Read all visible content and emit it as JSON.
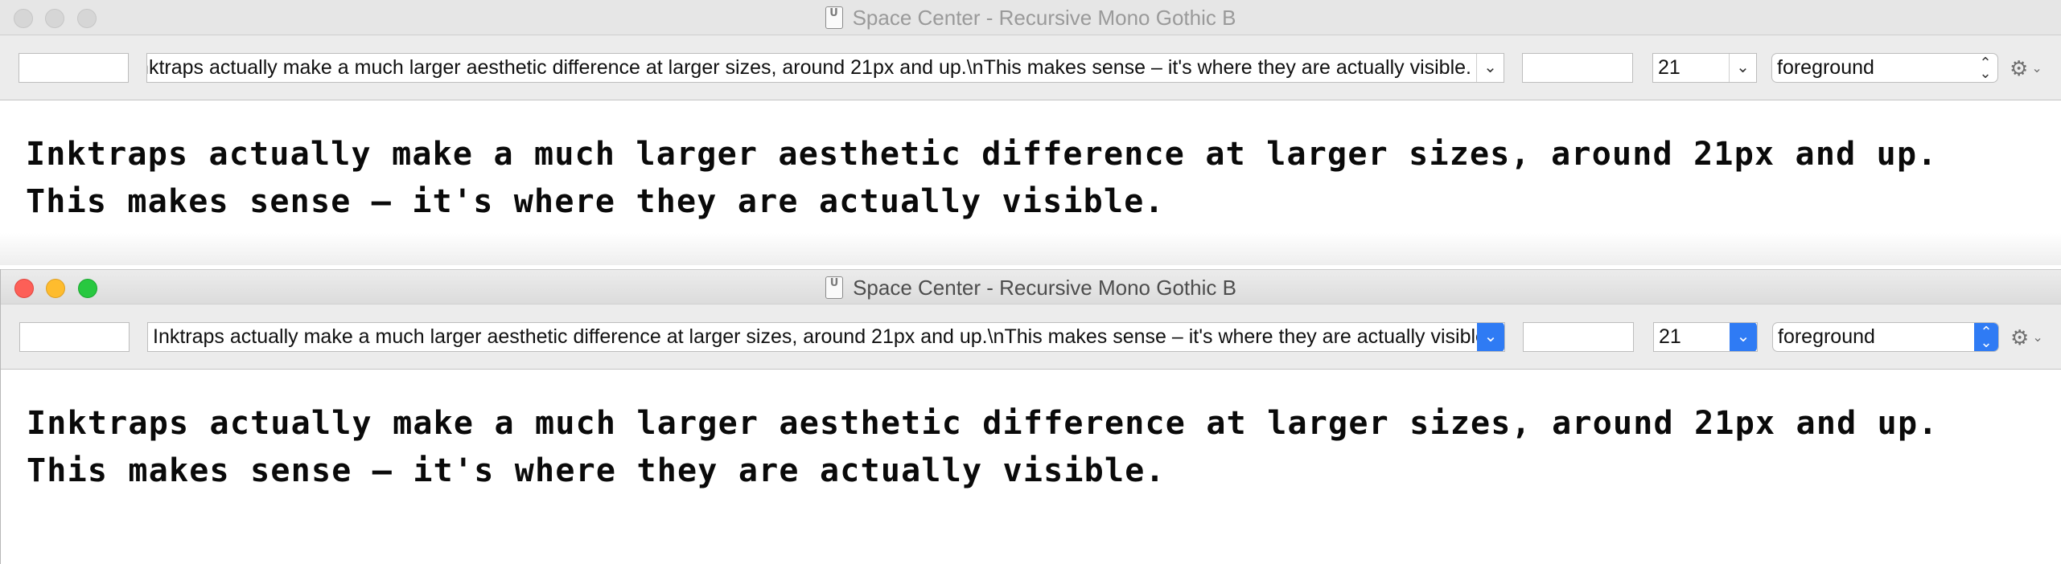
{
  "window_back": {
    "title": "Space Center - Recursive Mono Gothic B",
    "doc_icon_label": "U",
    "text_field": "Inktraps actually make a much larger aesthetic difference at larger sizes, around 21px and up.\\nThis makes sense – it's where they are actually visible.",
    "size_value": "21",
    "layer_value": "foreground",
    "preview_lines": [
      "Inktraps actually make a much larger aesthetic difference at larger sizes, around 21px and up.",
      "This makes sense – it's where they are actually visible."
    ]
  },
  "window_front": {
    "title": "Space Center - Recursive Mono Gothic B",
    "doc_icon_label": "U",
    "text_field": "Inktraps actually make a much larger aesthetic difference at larger sizes, around 21px and up.\\nThis makes sense – it's where they are actually visible.",
    "size_value": "21",
    "layer_value": "foreground",
    "preview_lines": [
      "Inktraps actually make a much larger aesthetic difference at larger sizes, around 21px and up.",
      "This makes sense – it's where they are actually visible."
    ]
  },
  "icons": {
    "dropdown": "chevron-down-icon",
    "stepper": "up-down-arrows-icon",
    "settings": "gear-icon",
    "document": "ufo-document-icon"
  },
  "colors": {
    "close": "#fd5f57",
    "minimize": "#febc2e",
    "zoom": "#28c840",
    "accent": "#2f7bf4"
  }
}
